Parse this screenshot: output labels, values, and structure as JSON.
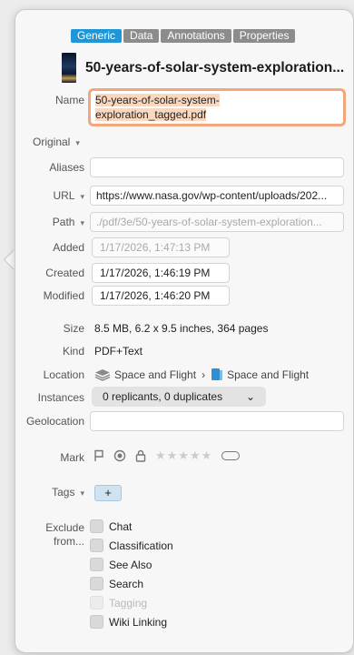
{
  "tabs": [
    "Generic",
    "Data",
    "Annotations",
    "Properties"
  ],
  "document": {
    "title": "50-years-of-solar-system-exploration..."
  },
  "labels": {
    "name": "Name",
    "original": "Original",
    "aliases": "Aliases",
    "url": "URL",
    "path": "Path",
    "added": "Added",
    "created": "Created",
    "modified": "Modified",
    "size": "Size",
    "kind": "Kind",
    "location": "Location",
    "instances": "Instances",
    "geolocation": "Geolocation",
    "mark": "Mark",
    "tags": "Tags",
    "exclude": "Exclude from..."
  },
  "fields": {
    "name_line1": "50-years-of-solar-system-",
    "name_line2": "exploration_tagged.pdf",
    "aliases": "",
    "url": "https://www.nasa.gov/wp-content/uploads/202...",
    "path": "./pdf/3e/50-years-of-solar-system-exploration...",
    "added": "1/17/2026,   1:47:13 PM",
    "created": "1/17/2026,   1:46:19 PM",
    "modified": "1/17/2026,   1:46:20 PM",
    "size": "8.5 MB, 6.2 x 9.5 inches, 364 pages",
    "kind": "PDF+Text",
    "location_db": "Space and Flight",
    "location_group": "Space and Flight",
    "instances": "0 replicants, 0 duplicates",
    "geolocation": ""
  },
  "mark": {
    "stars": "★★★★★"
  },
  "tags": {
    "add": "+"
  },
  "exclude": [
    {
      "label": "Chat",
      "enabled": true
    },
    {
      "label": "Classification",
      "enabled": true
    },
    {
      "label": "See Also",
      "enabled": true
    },
    {
      "label": "Search",
      "enabled": true
    },
    {
      "label": "Tagging",
      "enabled": false
    },
    {
      "label": "Wiki Linking",
      "enabled": true
    }
  ],
  "colors": {
    "active_tab": "#1f96d8",
    "focus_ring": "#f1a67b",
    "selection": "#fbd7be"
  }
}
